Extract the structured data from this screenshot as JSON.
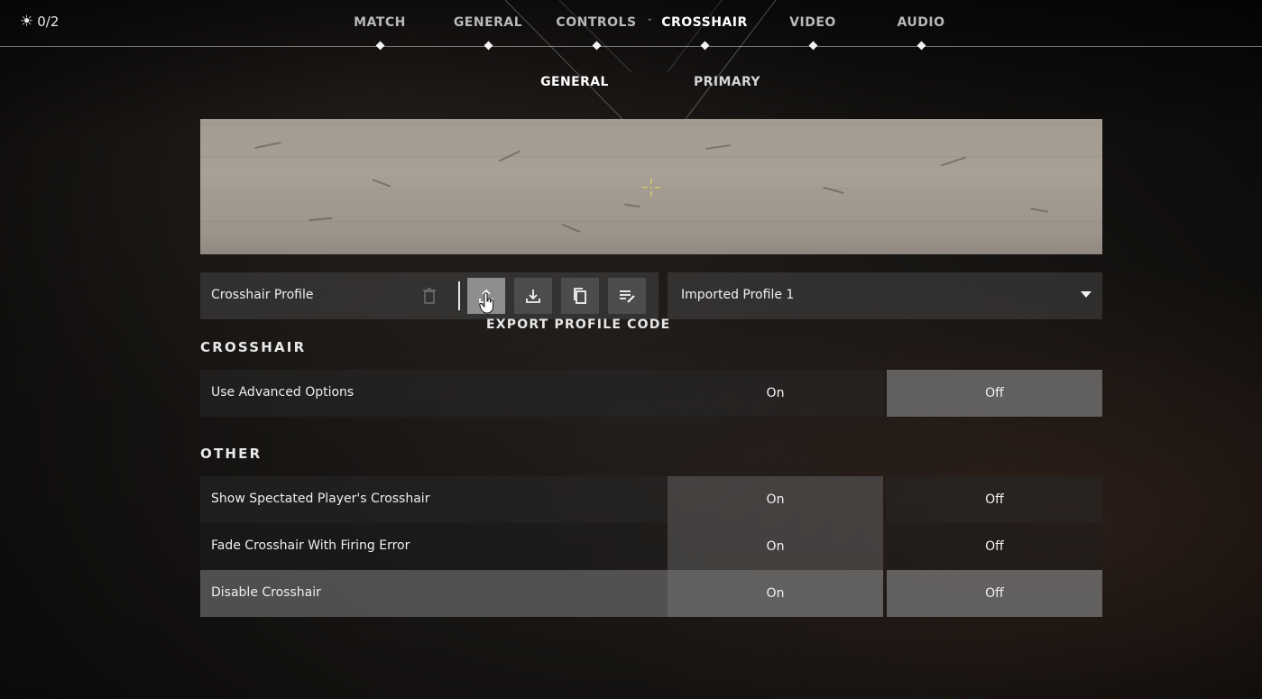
{
  "header": {
    "points": "0/2",
    "nav_tabs": [
      {
        "label": "MATCH",
        "active": false
      },
      {
        "label": "GENERAL",
        "active": false
      },
      {
        "label": "CONTROLS",
        "active": false
      },
      {
        "label": "CROSSHAIR",
        "active": true
      },
      {
        "label": "VIDEO",
        "active": false
      },
      {
        "label": "AUDIO",
        "active": false
      }
    ]
  },
  "subtabs": [
    {
      "label": "GENERAL",
      "active": true
    },
    {
      "label": "PRIMARY",
      "active": false
    }
  ],
  "profile": {
    "label": "Crosshair Profile",
    "selected": "Imported Profile 1",
    "tooltip": "EXPORT PROFILE CODE",
    "icons": [
      "trash-icon",
      "export-icon",
      "import-icon",
      "copy-icon",
      "rename-icon"
    ]
  },
  "sections": {
    "crosshair": "CROSSHAIR",
    "other": "OTHER"
  },
  "options": {
    "advanced": {
      "label": "Use Advanced Options",
      "on": "On",
      "off": "Off",
      "selected": "Off"
    },
    "spectated": {
      "label": "Show Spectated Player's Crosshair",
      "on": "On",
      "off": "Off",
      "selected": "On"
    },
    "fade": {
      "label": "Fade Crosshair With Firing Error",
      "on": "On",
      "off": "Off",
      "selected": "On"
    },
    "disable": {
      "label": "Disable Crosshair",
      "on": "On",
      "off": "Off",
      "selected": "On"
    }
  },
  "colors": {
    "crosshair": "#d9c96a",
    "accent": "#ffffff"
  }
}
